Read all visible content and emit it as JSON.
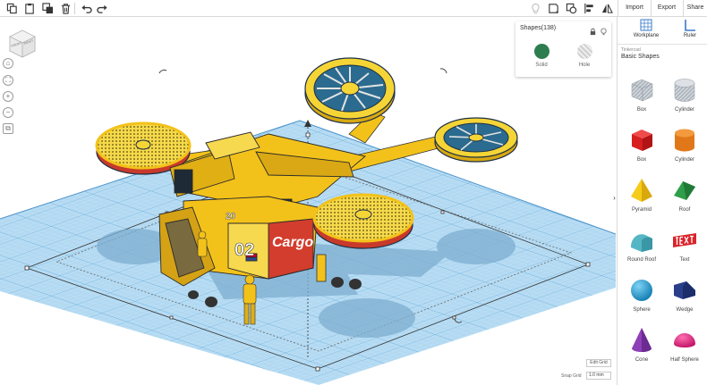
{
  "toolbar": {
    "left_icons": [
      "copy-icon",
      "paste-icon",
      "duplicate-icon",
      "delete-icon",
      "undo-icon",
      "redo-icon"
    ],
    "right_icons": [
      "light-icon",
      "note-icon",
      "group-icon",
      "ungroup-icon",
      "align-icon",
      "mirror-icon"
    ],
    "import_label": "Import",
    "export_label": "Export",
    "share_label": "Share"
  },
  "viewcube": {
    "front_label": "FRONT",
    "right_label": "RIGHT"
  },
  "shapes_panel": {
    "title": "Shapes(138)",
    "solid_label": "Solid",
    "hole_label": "Hole",
    "solid_color": "#2e7d4f"
  },
  "grid": {
    "edit_label": "Edit Grid",
    "snap_label": "Snap Grid",
    "snap_value": "1.0 mm"
  },
  "scene": {
    "cargo_number": "02",
    "cargo_text": "Cargo",
    "rotor_number": "20"
  },
  "right_panel": {
    "workplane_label": "Workplane",
    "ruler_label": "Ruler",
    "source_label": "Tinkercad",
    "category_label": "Basic Shapes",
    "shapes": [
      {
        "label": "Box",
        "icon": "box-hole-icon"
      },
      {
        "label": "Cylinder",
        "icon": "cylinder-hole-icon"
      },
      {
        "label": "Box",
        "icon": "box-icon"
      },
      {
        "label": "Cylinder",
        "icon": "cylinder-icon"
      },
      {
        "label": "Pyramid",
        "icon": "pyramid-icon"
      },
      {
        "label": "Roof",
        "icon": "roof-icon"
      },
      {
        "label": "Round Roof",
        "icon": "round-roof-icon"
      },
      {
        "label": "Text",
        "icon": "text-shape-icon"
      },
      {
        "label": "Sphere",
        "icon": "sphere-icon"
      },
      {
        "label": "Wedge",
        "icon": "wedge-icon"
      },
      {
        "label": "Cone",
        "icon": "cone-icon"
      },
      {
        "label": "Half Sphere",
        "icon": "half-sphere-icon"
      }
    ]
  }
}
